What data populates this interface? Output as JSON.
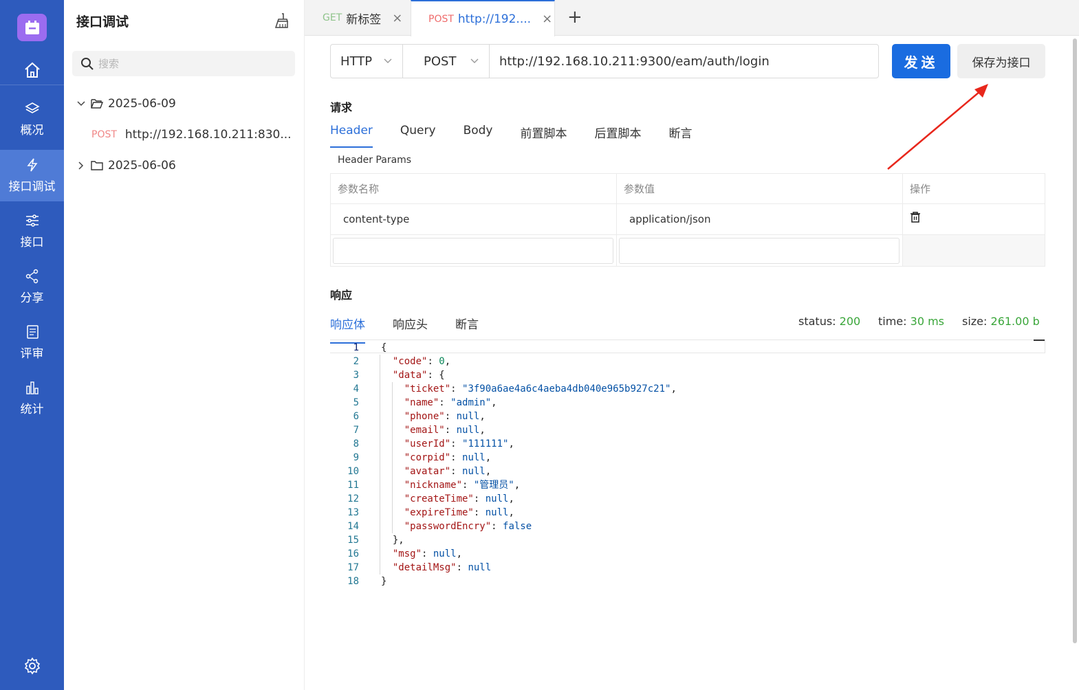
{
  "sidebar": {
    "items": [
      {
        "label": "概况"
      },
      {
        "label": "接口调试"
      },
      {
        "label": "接口"
      },
      {
        "label": "分享"
      },
      {
        "label": "评审"
      },
      {
        "label": "统计"
      }
    ]
  },
  "panel": {
    "title": "接口调试",
    "search_placeholder": "搜索",
    "folders": [
      {
        "date": "2025-06-09",
        "expanded": true
      },
      {
        "date": "2025-06-06",
        "expanded": false
      }
    ],
    "leaf": {
      "method": "POST",
      "url": "http://192.168.10.211:830..."
    }
  },
  "tabs": {
    "tab1": {
      "method": "GET",
      "title": "新标签"
    },
    "tab2": {
      "method": "POST",
      "title": "http://192...."
    },
    "close": "×",
    "add": "+"
  },
  "request": {
    "protocol": "HTTP",
    "method": "POST",
    "url": "http://192.168.10.211:9300/eam/auth/login",
    "send_label": "发送",
    "save_label": "保存为接口",
    "section_label": "请求",
    "tabs": [
      "Header",
      "Query",
      "Body",
      "前置脚本",
      "后置脚本",
      "断言"
    ],
    "header_params_label": "Header Params",
    "columns": [
      "参数名称",
      "参数值",
      "操作"
    ],
    "rows": [
      {
        "name": "content-type",
        "value": "application/json"
      }
    ]
  },
  "response": {
    "section_label": "响应",
    "tabs": [
      "响应体",
      "响应头",
      "断言"
    ],
    "status_label": "status:",
    "status": "200",
    "time_label": "time:",
    "time": "30 ms",
    "size_label": "size:",
    "size": "261.00 b",
    "line_numbers": [
      "1",
      "2",
      "3",
      "4",
      "5",
      "6",
      "7",
      "8",
      "9",
      "10",
      "11",
      "12",
      "13",
      "14",
      "15",
      "16",
      "17",
      "18"
    ]
  },
  "colors": {
    "nav_bg": "#2e5bbd",
    "nav_active": "#4f7bd6",
    "accent": "#1a6ce0",
    "success": "#3aa63a"
  }
}
